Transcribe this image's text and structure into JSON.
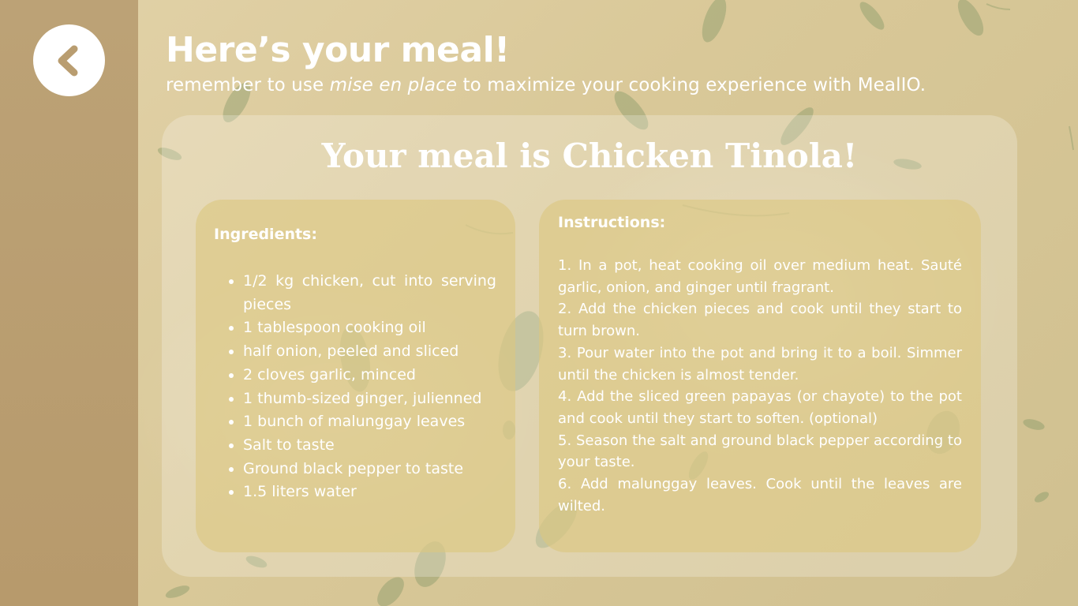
{
  "nav": {
    "back_icon": "chevron-left-icon"
  },
  "header": {
    "title": "Here’s your meal!",
    "subtitle_before": "remember to use ",
    "subtitle_emphasis": "mise en place",
    "subtitle_after": " to maximize your cooking experience with MealIO."
  },
  "meal": {
    "title": "Your meal is Chicken Tinola!"
  },
  "ingredients": {
    "heading": "Ingredients:",
    "items": [
      "1/2 kg chicken, cut into serving pieces",
      "1 tablespoon cooking oil",
      "half onion, peeled and sliced",
      "2 cloves garlic, minced",
      "1 thumb-sized ginger, julienned",
      "1 bunch of malunggay leaves",
      "Salt to taste",
      "Ground black pepper to taste",
      "1.5 liters water"
    ]
  },
  "instructions": {
    "heading": "Instructions:",
    "steps": [
      "1. In a pot, heat cooking oil over medium heat. Sauté garlic, onion, and ginger until fragrant.",
      "2. Add the chicken pieces and cook until they start to turn brown.",
      "3. Pour water into the pot and bring it to a boil. Simmer until the chicken is almost tender.",
      "4. Add the sliced green papayas (or chayote) to the pot and cook until they start to soften. (optional)",
      "5. Season the salt and ground black pepper according to your taste.",
      "6. Add malunggay leaves. Cook until the leaves are wilted."
    ]
  },
  "theme": {
    "background": "#d9c898",
    "sidebar": "#b99d70",
    "leaf": "#8a9a6a",
    "text": "#ffffff"
  }
}
